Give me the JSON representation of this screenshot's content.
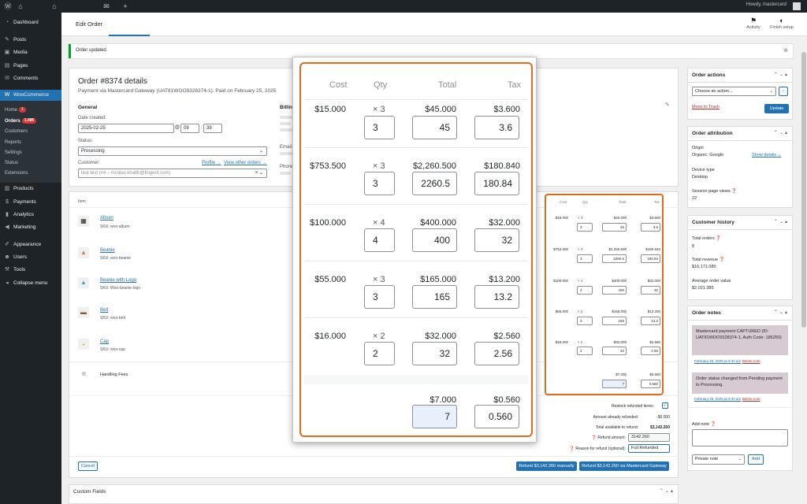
{
  "adminbar": {
    "wp_icon": "wordpress-icon",
    "howdy": "Howdy, mastercard"
  },
  "sidebar": {
    "items": [
      {
        "label": "Dashboard",
        "icon": "◔"
      },
      {
        "label": "Posts",
        "icon": "✎"
      },
      {
        "label": "Media",
        "icon": "▣"
      },
      {
        "label": "Pages",
        "icon": "▤"
      },
      {
        "label": "Comments",
        "icon": "✉"
      },
      {
        "label": "WooCommerce",
        "icon": "W"
      },
      {
        "label": "Products",
        "icon": "▥"
      },
      {
        "label": "Payments",
        "icon": "$"
      },
      {
        "label": "Analytics",
        "icon": "▮"
      },
      {
        "label": "Marketing",
        "icon": "◀"
      },
      {
        "label": "Appearance",
        "icon": "✐"
      },
      {
        "label": "Users",
        "icon": "☻"
      },
      {
        "label": "Tools",
        "icon": "⚒"
      },
      {
        "label": "Collapse menu",
        "icon": "◂"
      }
    ],
    "sub": {
      "home": "Home",
      "home_badge": "1",
      "orders": "Orders",
      "orders_badge": "1,496",
      "customers": "Customers",
      "reports": "Reports",
      "settings": "Settings",
      "status": "Status",
      "extensions": "Extensions"
    }
  },
  "topbar": {
    "title": "Edit Order",
    "activity": "Activity",
    "finish": "Finish setup"
  },
  "notice": "Order updated.",
  "order": {
    "title": "Order #8374 details",
    "subtitle": "Payment via Mastercard Gateway (UAT81WOO9328374-1). Paid on February 25, 2025",
    "general": "General",
    "billing": "Billing",
    "date_created_label": "Date created:",
    "date": "2025-02-25",
    "at": "@",
    "hour": "09",
    "minute": "39",
    "status_label": "Status:",
    "status": "Processing",
    "customer_label": "Customer:",
    "profile_link": "Profile →",
    "other_orders_link": "View other orders →",
    "customer_value": "test test (#4 – nicolas.khatib@fingent.com)",
    "email_label": "Email a",
    "phone_label": "Phone"
  },
  "items": {
    "header": "Item",
    "rows": [
      {
        "name": "Album",
        "sku": "SKU: woo-album"
      },
      {
        "name": "Beanie",
        "sku": "SKU: woo-beanie"
      },
      {
        "name": "Beanie with Logo",
        "sku": "SKU: Woo-beanie-logo"
      },
      {
        "name": "Belt",
        "sku": "SKU: woo-belt"
      },
      {
        "name": "Cap",
        "sku": "SKU: woo-cap"
      }
    ],
    "fee": "Handling Fees"
  },
  "refund": {
    "restock": "Restock refunded items:",
    "already": "Amount already refunded:",
    "already_value": "-$0.000",
    "available": "Total available to refund:",
    "available_value": "$3,142.260",
    "amount_label": "Refund amount:",
    "amount_value": "3142.260",
    "reason_label": "Reason for refund (optional):",
    "reason_value": "Full Refunded",
    "cancel": "Cancel",
    "manual": "Refund $3,142.260 manually",
    "gateway": "Refund $3,142.260 via Mastercard Gateway"
  },
  "custom_fields": "Custom Fields",
  "popover": {
    "headers": {
      "cost": "Cost",
      "qty": "Qty",
      "total": "Total",
      "tax": "Tax"
    },
    "rows": [
      {
        "cost": "$15.000",
        "qty": "× 3",
        "total": "$45.000",
        "tax": "$3.600",
        "qty_in": "3",
        "total_in": "45",
        "tax_in": "3.6"
      },
      {
        "cost": "$753.500",
        "qty": "× 3",
        "total": "$2,260.500",
        "tax": "$180.840",
        "qty_in": "3",
        "total_in": "2260.5",
        "tax_in": "180.84"
      },
      {
        "cost": "$100.000",
        "qty": "× 4",
        "total": "$400.000",
        "tax": "$32.000",
        "qty_in": "4",
        "total_in": "400",
        "tax_in": "32"
      },
      {
        "cost": "$55.000",
        "qty": "× 3",
        "total": "$165.000",
        "tax": "$13.200",
        "qty_in": "3",
        "total_in": "165",
        "tax_in": "13.2"
      },
      {
        "cost": "$16.000",
        "qty": "× 2",
        "total": "$32.000",
        "tax": "$2.560",
        "qty_in": "2",
        "total_in": "32",
        "tax_in": "2.56"
      }
    ],
    "fee": {
      "total": "$7.000",
      "tax": "$0.560",
      "total_in": "7",
      "tax_in": "0.560"
    }
  },
  "actions": {
    "title": "Order actions",
    "select": "Choose an action...",
    "trash": "Move to Trash",
    "update": "Update"
  },
  "attribution": {
    "title": "Order attribution",
    "origin_label": "Origin",
    "origin": "Organic: Google",
    "show_details": "Show details",
    "device_label": "Device type",
    "device": "Desktop",
    "views_label": "Session page views",
    "views": "22"
  },
  "history": {
    "title": "Customer history",
    "orders_label": "Total orders",
    "orders": "8",
    "revenue_label": "Total revenue",
    "revenue": "$16,171.080",
    "avg_label": "Average order value",
    "avg": "$2,021.385"
  },
  "notes": {
    "title": "Order notes",
    "note1": "Mastercard payment CAPTURED (ID: UAT81WOO9328374-1, Auth Code: 186250)",
    "meta1": "February 25, 2025 at 9:40 am",
    "note2": "Order status changed from Pending payment to Processing.",
    "meta2": "February 25, 2025 at 9:40 am",
    "delete": "Delete note",
    "add_label": "Add note",
    "type": "Private note",
    "add": "Add"
  }
}
